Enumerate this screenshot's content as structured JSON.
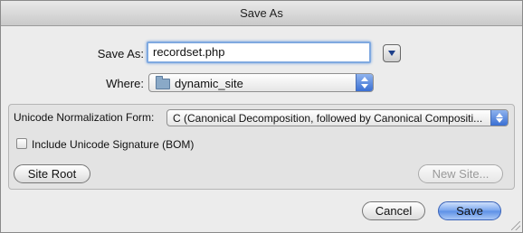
{
  "window": {
    "title": "Save As"
  },
  "save_as": {
    "label": "Save As:",
    "value": "recordset.php"
  },
  "where": {
    "label": "Where:",
    "selected": "dynamic_site"
  },
  "unicode": {
    "label": "Unicode Normalization Form:",
    "selected": "C (Canonical Decomposition, followed by Canonical Compositi..."
  },
  "bom": {
    "label": "Include Unicode Signature (BOM)",
    "checked": false
  },
  "buttons": {
    "site_root": "Site Root",
    "new_site": "New Site...",
    "cancel": "Cancel",
    "save": "Save"
  },
  "icons": {
    "expand": "chevron-down-icon",
    "folder": "folder-icon",
    "stepper": "up-down-arrows-icon"
  }
}
